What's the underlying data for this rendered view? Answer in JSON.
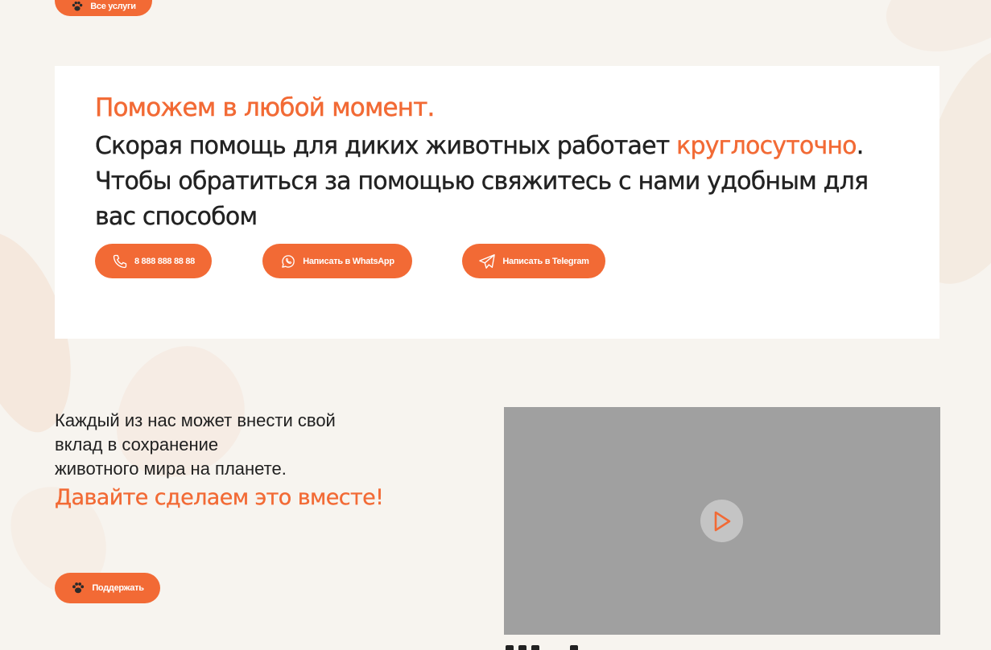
{
  "top": {
    "services_button_label": "Все услуги"
  },
  "help": {
    "title": "Поможем в любой момент.",
    "text_part1": "Скорая помощь для диких животных работает ",
    "text_accent": "круглосуточно",
    "text_part2": ". Чтобы обратиться за помощью свяжитесь с нами удобным для вас способом",
    "phone_label": "8 888 888 88 88",
    "whatsapp_label": "Написать в WhatsApp",
    "telegram_label": "Написать в Telegram"
  },
  "support": {
    "lines": [
      "Каждый из нас может внести свой",
      "вклад в сохранение",
      "животного мира на планете."
    ],
    "cta": "Давайте сделаем это вместе!",
    "button_label": "Поддержать"
  },
  "colors": {
    "accent": "#f26a35",
    "background": "#f7f4ef",
    "card": "#ffffff",
    "video_placeholder": "#a0a0a0"
  },
  "icons": {
    "services": "paw-icon",
    "phone": "phone-icon",
    "whatsapp": "whatsapp-icon",
    "telegram": "telegram-icon",
    "support": "paw-icon",
    "play": "play-icon"
  }
}
